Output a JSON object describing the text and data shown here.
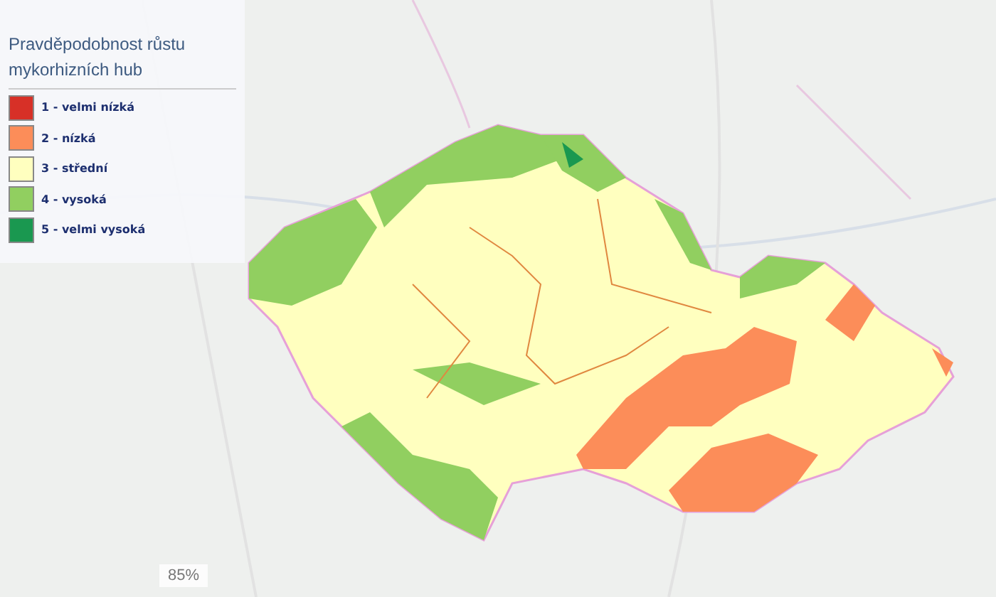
{
  "legend": {
    "title": "Pravděpodobnost růstu mykorhizních hub",
    "items": [
      {
        "label": "1 - velmi nízká",
        "color": "#d73027"
      },
      {
        "label": "2 - nízká",
        "color": "#fc8d59"
      },
      {
        "label": "3 - střední",
        "color": "#ffffbf"
      },
      {
        "label": "4 - vysoká",
        "color": "#91cf60"
      },
      {
        "label": "5 - velmi vysoká",
        "color": "#1a9850"
      }
    ]
  },
  "opacity": {
    "value": "85%"
  }
}
